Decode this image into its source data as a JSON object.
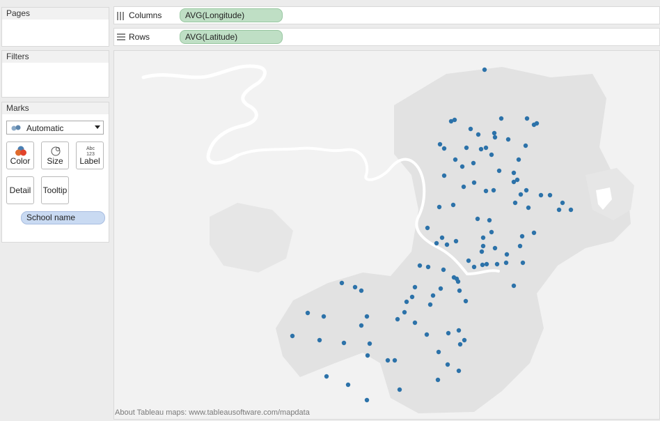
{
  "cards": {
    "pages_title": "Pages",
    "filters_title": "Filters",
    "marks_title": "Marks"
  },
  "marks": {
    "mark_type": "Automatic",
    "buttons": {
      "color": "Color",
      "size": "Size",
      "label": "Label",
      "label_icon_text": "Abc 123",
      "detail": "Detail",
      "tooltip": "Tooltip"
    },
    "detail_pill": "School name"
  },
  "shelves": {
    "columns_label": "Columns",
    "columns_pill": "AVG(Longitude)",
    "rows_label": "Rows",
    "rows_pill": "AVG(Latitude)"
  },
  "map": {
    "attribution": "About Tableau maps: www.tableausoftware.com/mapdata",
    "mark_color": "#2c72a9",
    "water_color": "#ffffff",
    "urban_color": "#e2e2e2",
    "land_color": "#f2f2f2"
  },
  "chart_data": {
    "type": "scatter",
    "x_label": "AVG(Longitude)",
    "y_label": "AVG(Latitude)",
    "points": [
      [
        695,
        99
      ],
      [
        647,
        173
      ],
      [
        652,
        171
      ],
      [
        675,
        184
      ],
      [
        686,
        192
      ],
      [
        709,
        190
      ],
      [
        710,
        196
      ],
      [
        719,
        169
      ],
      [
        729,
        199
      ],
      [
        756,
        169
      ],
      [
        766,
        178
      ],
      [
        770,
        176
      ],
      [
        754,
        208
      ],
      [
        631,
        206
      ],
      [
        637,
        212
      ],
      [
        669,
        211
      ],
      [
        697,
        211
      ],
      [
        705,
        221
      ],
      [
        690,
        213
      ],
      [
        653,
        228
      ],
      [
        663,
        238
      ],
      [
        679,
        233
      ],
      [
        744,
        228
      ],
      [
        737,
        247
      ],
      [
        716,
        244
      ],
      [
        737,
        260
      ],
      [
        742,
        257
      ],
      [
        637,
        251
      ],
      [
        680,
        261
      ],
      [
        697,
        273
      ],
      [
        665,
        267
      ],
      [
        708,
        272
      ],
      [
        755,
        272
      ],
      [
        747,
        278
      ],
      [
        776,
        279
      ],
      [
        789,
        279
      ],
      [
        739,
        290
      ],
      [
        758,
        297
      ],
      [
        807,
        290
      ],
      [
        802,
        300
      ],
      [
        819,
        300
      ],
      [
        650,
        293
      ],
      [
        630,
        296
      ],
      [
        685,
        313
      ],
      [
        702,
        315
      ],
      [
        613,
        326
      ],
      [
        705,
        332
      ],
      [
        766,
        333
      ],
      [
        634,
        340
      ],
      [
        654,
        345
      ],
      [
        693,
        340
      ],
      [
        626,
        348
      ],
      [
        641,
        350
      ],
      [
        693,
        352
      ],
      [
        691,
        360
      ],
      [
        710,
        355
      ],
      [
        727,
        364
      ],
      [
        746,
        352
      ],
      [
        749,
        338
      ],
      [
        672,
        373
      ],
      [
        680,
        382
      ],
      [
        692,
        379
      ],
      [
        698,
        378
      ],
      [
        713,
        378
      ],
      [
        726,
        376
      ],
      [
        750,
        376
      ],
      [
        602,
        380
      ],
      [
        614,
        382
      ],
      [
        636,
        386
      ],
      [
        651,
        397
      ],
      [
        655,
        399
      ],
      [
        657,
        403
      ],
      [
        490,
        405
      ],
      [
        509,
        411
      ],
      [
        518,
        416
      ],
      [
        595,
        411
      ],
      [
        632,
        413
      ],
      [
        659,
        416
      ],
      [
        668,
        431
      ],
      [
        737,
        409
      ],
      [
        621,
        423
      ],
      [
        591,
        425
      ],
      [
        617,
        436
      ],
      [
        583,
        432
      ],
      [
        441,
        448
      ],
      [
        464,
        453
      ],
      [
        526,
        453
      ],
      [
        570,
        457
      ],
      [
        580,
        447
      ],
      [
        595,
        462
      ],
      [
        518,
        466
      ],
      [
        612,
        479
      ],
      [
        643,
        477
      ],
      [
        658,
        473
      ],
      [
        660,
        493
      ],
      [
        666,
        487
      ],
      [
        419,
        481
      ],
      [
        458,
        487
      ],
      [
        493,
        491
      ],
      [
        530,
        492
      ],
      [
        629,
        504
      ],
      [
        527,
        509
      ],
      [
        556,
        516
      ],
      [
        566,
        516
      ],
      [
        642,
        522
      ],
      [
        658,
        531
      ],
      [
        468,
        539
      ],
      [
        499,
        551
      ],
      [
        573,
        558
      ],
      [
        628,
        544
      ],
      [
        526,
        573
      ]
    ]
  }
}
